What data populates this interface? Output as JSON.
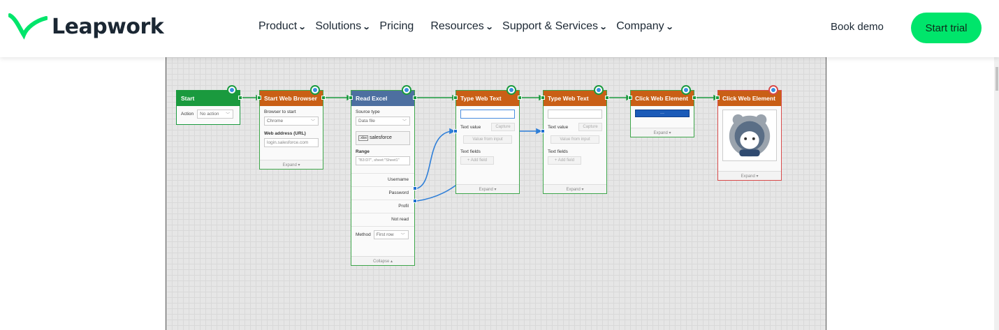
{
  "brand": {
    "name": "Leapwork",
    "logo_icon": "leapwork-check-icon",
    "accent": "#00e56b"
  },
  "nav": {
    "items": [
      {
        "label": "Product",
        "has_dropdown": true
      },
      {
        "label": "Solutions",
        "has_dropdown": true
      },
      {
        "label": "Pricing",
        "has_dropdown": false
      },
      {
        "label": "Resources",
        "has_dropdown": true
      },
      {
        "label": "Support & Services",
        "has_dropdown": true
      },
      {
        "label": "Company",
        "has_dropdown": true
      }
    ],
    "dropdown_glyph": "⌄",
    "book_demo": "Book demo",
    "start_trial": "Start trial"
  },
  "flow": {
    "start": {
      "title": "Start",
      "action_label": "Action",
      "action_value": "No action"
    },
    "browser": {
      "title": "Start Web Browser",
      "browser_label": "Browser to start",
      "browser_value": "Chrome",
      "url_label": "Web address (URL)",
      "url_value": "login.salesforce.com",
      "expand": "Expand ▾"
    },
    "excel": {
      "title": "Read Excel",
      "source_label": "Source type",
      "source_value": "Data file",
      "file_ext": ".xlsx",
      "file_name": "salesforce",
      "range_label": "Range",
      "range_value": "\"B3:D7\", sheet:\"Sheet1\"",
      "outputs": [
        "Username",
        "Password",
        "Profil",
        "Not read"
      ],
      "method_label": "Method",
      "method_value": "First row",
      "collapse": "Collapse ▴"
    },
    "type1": {
      "title": "Type Web Text",
      "text_value_label": "Text value",
      "capture": "Capture",
      "value_from_input": "Value from input",
      "text_fields_label": "Text fields",
      "add_field": "+ Add field",
      "expand": "Expand ▾"
    },
    "type2": {
      "title": "Type Web Text",
      "text_value_label": "Text value",
      "capture": "Capture",
      "value_from_input": "Value from input",
      "text_fields_label": "Text fields",
      "add_field": "+ Add field",
      "expand": "Expand ▾"
    },
    "click1": {
      "title": "Click Web Element",
      "element_preview": "···",
      "expand": "Expand ▾"
    },
    "click2": {
      "title": "Click Web Element",
      "image_icon": "robot-avatar-icon",
      "expand": "Expand ▾"
    }
  }
}
